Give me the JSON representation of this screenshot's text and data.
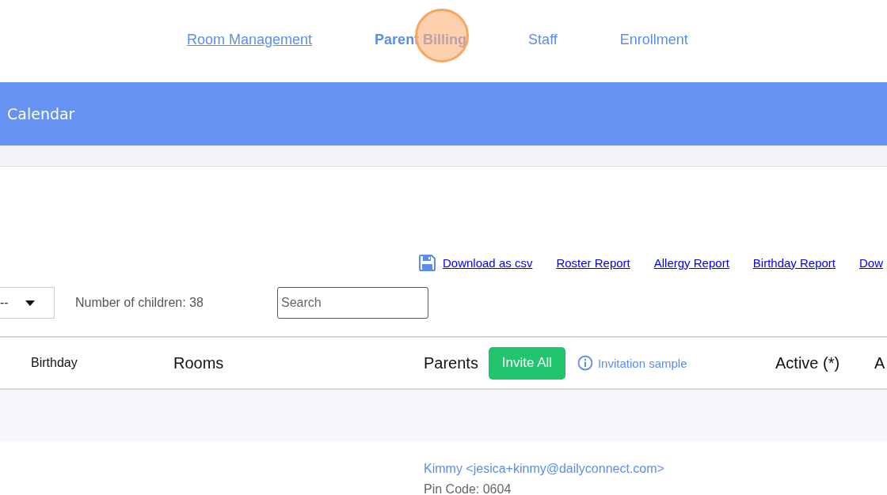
{
  "nav": [
    {
      "label": "Room Management",
      "selected": false,
      "underlined": true
    },
    {
      "label": "Parent Billing",
      "selected": true,
      "underlined": false
    },
    {
      "label": "Staff",
      "selected": false,
      "underlined": false
    },
    {
      "label": "Enrollment",
      "selected": false,
      "underlined": false
    }
  ],
  "header_bar": {
    "title": "Calendar"
  },
  "report_links": [
    {
      "label": "Download as csv",
      "kind": "download"
    },
    {
      "label": "Roster Report",
      "kind": "link"
    },
    {
      "label": "Allergy Report",
      "kind": "link"
    },
    {
      "label": "Birthday Report",
      "kind": "link"
    },
    {
      "label": "Dow",
      "kind": "link"
    }
  ],
  "filter": {
    "value": "--"
  },
  "children_count": "Number of children: 38",
  "search": {
    "placeholder": "Search"
  },
  "table": {
    "columns": [
      {
        "label": "Birthday",
        "kind": "small"
      },
      {
        "label": "Rooms",
        "kind": "plain"
      },
      {
        "label": "Parents",
        "kind": "parents",
        "button": "Invite All",
        "link": "Invitation sample"
      },
      {
        "label": "Active (*)",
        "kind": "plain"
      },
      {
        "label": "A",
        "kind": "plain"
      }
    ],
    "rows": [
      {
        "parent": "Kimmy <jesica+kinmy@dailyconnect.com>",
        "pin": "Pin Code: 0604"
      }
    ]
  }
}
